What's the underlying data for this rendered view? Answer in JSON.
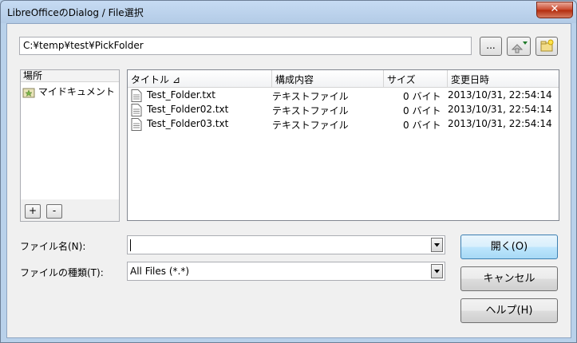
{
  "window": {
    "title": "LibreOfficeのDialog / File選択",
    "close_label": "✕"
  },
  "toolbar": {
    "path_value": "C:¥temp¥test¥PickFolder",
    "browse_label": "...",
    "up_icon": "folder-up-icon",
    "new_folder_icon": "new-folder-icon"
  },
  "places": {
    "header": "場所",
    "items": [
      {
        "label": "マイドキュメント",
        "icon": "my-documents-icon"
      }
    ],
    "add_label": "+",
    "remove_label": "-"
  },
  "file_list": {
    "columns": [
      "タイトル ⊿",
      "構成内容",
      "サイズ",
      "変更日時"
    ],
    "rows": [
      {
        "title": "Test_Folder.txt",
        "type": "テキストファイル",
        "size": "0 バイト",
        "modified": "2013/10/31, 22:54:14"
      },
      {
        "title": "Test_Folder02.txt",
        "type": "テキストファイル",
        "size": "0 バイト",
        "modified": "2013/10/31, 22:54:14"
      },
      {
        "title": "Test_Folder03.txt",
        "type": "テキストファイル",
        "size": "0 バイト",
        "modified": "2013/10/31, 22:54:14"
      }
    ]
  },
  "form": {
    "filename_label": "ファイル名(N):",
    "filename_value": "",
    "filetype_label": "ファイルの種類(T):",
    "filetype_value": "All Files (*.*)"
  },
  "buttons": {
    "open": "開く(O)",
    "cancel": "キャンセル",
    "help": "ヘルプ(H)"
  },
  "colors": {
    "title_bg": "#b9d1ea",
    "close_red": "#c9462b",
    "default_button": "#a7d9f5"
  }
}
